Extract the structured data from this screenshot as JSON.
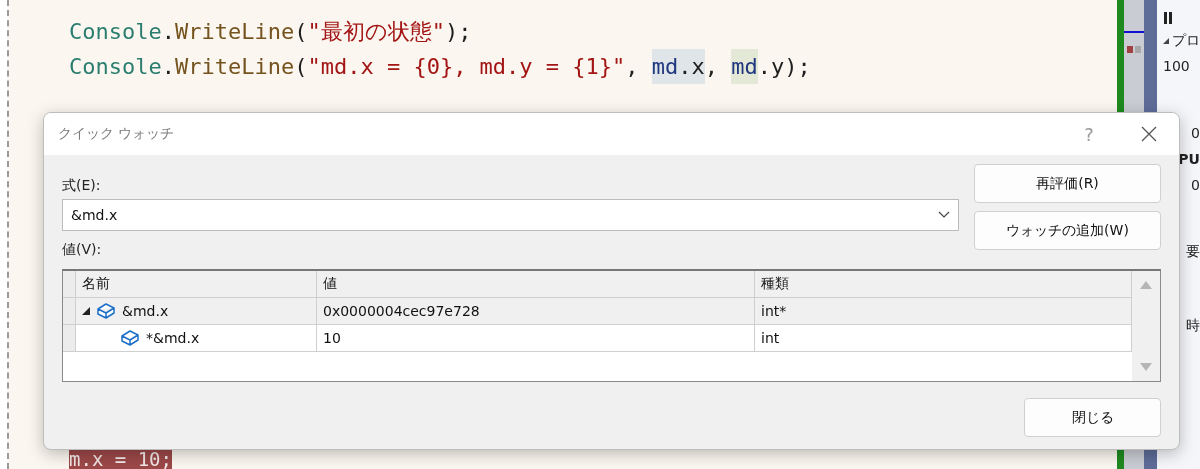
{
  "editor": {
    "lines": [
      [
        {
          "text": "Console",
          "kind": "class"
        },
        {
          "text": ".",
          "kind": "plain"
        },
        {
          "text": "WriteLine",
          "kind": "method"
        },
        {
          "text": "(",
          "kind": "plain"
        },
        {
          "text": "\"最初の状態\"",
          "kind": "string"
        },
        {
          "text": ");",
          "kind": "plain"
        }
      ],
      [
        {
          "text": "Console",
          "kind": "class"
        },
        {
          "text": ".",
          "kind": "plain"
        },
        {
          "text": "WriteLine",
          "kind": "method"
        },
        {
          "text": "(",
          "kind": "plain"
        },
        {
          "text": "\"md.x = {0}, md.y = {1}\"",
          "kind": "string"
        },
        {
          "text": ", ",
          "kind": "plain"
        },
        {
          "text": "md",
          "kind": "local",
          "color": "#dfe5e8"
        },
        {
          "text": ".x",
          "kind": "plain",
          "color": "#dfe5e8"
        },
        {
          "text": ", ",
          "kind": "plain"
        },
        {
          "text": "md",
          "kind": "local",
          "color": "#e4e8d6"
        },
        {
          "text": ".y);",
          "kind": "plain"
        }
      ]
    ],
    "lower_lines": [
      [
        {
          "text": "m.x = 10;",
          "kind": "breakpoint",
          "color": "#9c4848"
        }
      ]
    ]
  },
  "side_panel": {
    "items": [
      {
        "text": "プロ",
        "kind": "expander"
      },
      {
        "text": "100",
        "kind": "plain"
      }
    ],
    "lower_items": [
      {
        "text": "0",
        "kind": "plain"
      },
      {
        "text": "PU",
        "kind": "bold"
      },
      {
        "text": "0",
        "kind": "plain"
      },
      {
        "text": "要",
        "kind": "plain"
      },
      {
        "text": "時",
        "kind": "plain"
      }
    ]
  },
  "dialog": {
    "title": "クイック ウォッチ",
    "help_button": "?",
    "expression_label": "式(E):",
    "expression_value": "&md.x",
    "value_label": "値(V):",
    "buttons": [
      "再評価(R)",
      "ウォッチの追加(W)"
    ],
    "table": {
      "columns": [
        "名前",
        "値",
        "種類"
      ],
      "rows": [
        {
          "name": "&md.x",
          "value": "0x0000004cec97e728",
          "type": "int*",
          "selected": true,
          "expanded": true,
          "children": [
            {
              "name": "*&md.x",
              "value": "10",
              "type": "int",
              "selected": false
            }
          ]
        }
      ]
    },
    "close_button": "閉じる"
  }
}
